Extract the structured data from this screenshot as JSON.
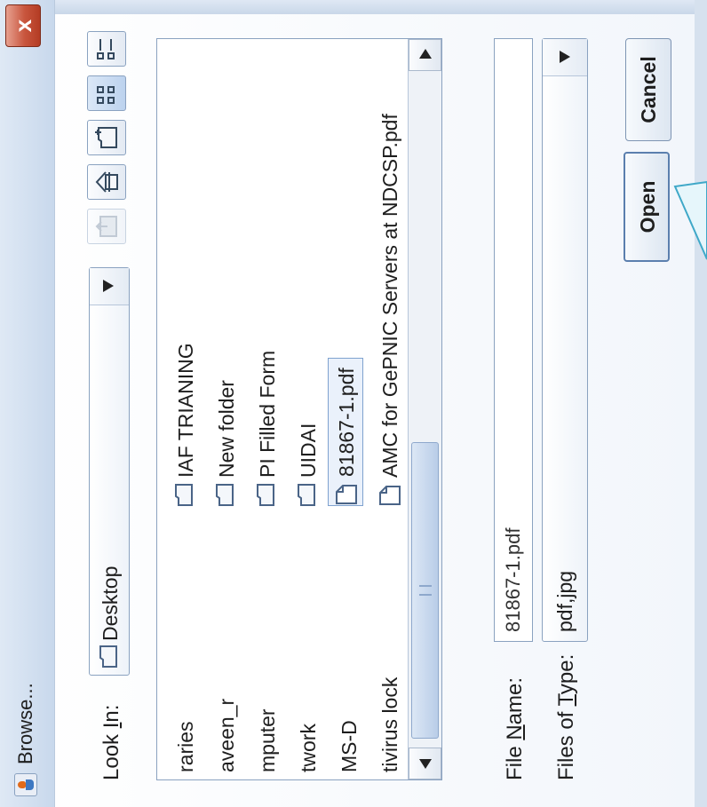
{
  "window": {
    "title": "Browse...",
    "close_symbol": "x"
  },
  "look_in": {
    "label_prefix": "Look ",
    "label_mnemonic": "I",
    "label_suffix": "n:",
    "value": "Desktop"
  },
  "toolbar": {
    "icons": [
      "up-folder-icon",
      "home-icon",
      "new-folder-icon",
      "list-view-icon",
      "details-view-icon"
    ]
  },
  "file_list": {
    "left_column": [
      "raries",
      "aveen_r",
      "mputer",
      "twork",
      "MS-D",
      "tivirus lock"
    ],
    "right_column": [
      {
        "label": "IAF TRIANING",
        "type": "folder"
      },
      {
        "label": "New folder",
        "type": "folder"
      },
      {
        "label": "PI Filled Form",
        "type": "folder"
      },
      {
        "label": "UIDAI",
        "type": "folder"
      },
      {
        "label": "81867-1.pdf",
        "type": "file",
        "selected": true
      },
      {
        "label": "AMC for GePNIC Servers at NDCSP.pdf",
        "type": "file"
      }
    ]
  },
  "file_name": {
    "label_prefix": "File ",
    "label_mnemonic": "N",
    "label_suffix": "ame:",
    "value": "81867-1.pdf"
  },
  "files_of_type": {
    "label_prefix": "Files of ",
    "label_mnemonic": "T",
    "label_suffix": "ype:",
    "value": "pdf,jpg"
  },
  "buttons": {
    "open": "Open",
    "cancel": "Cancel"
  },
  "colors": {
    "accent": "#5b7fae",
    "close": "#c8553d",
    "callout": "#e6f6fb"
  }
}
